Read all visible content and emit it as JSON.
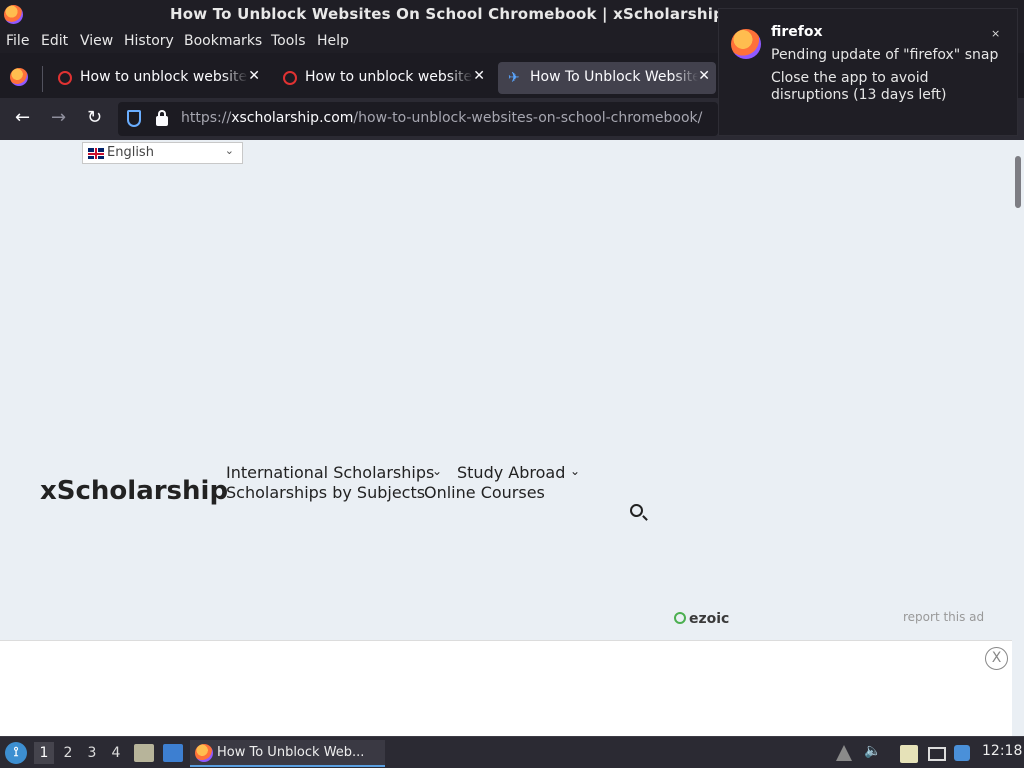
{
  "window": {
    "title": "How To Unblock Websites On School Chromebook | xScholarship -"
  },
  "menu": [
    "File",
    "Edit",
    "View",
    "History",
    "Bookmarks",
    "Tools",
    "Help"
  ],
  "tabs": [
    {
      "label": "How to unblock websites",
      "icon": "quora-icon",
      "active": false
    },
    {
      "label": "How to unblock websites",
      "icon": "quora-icon",
      "active": false
    },
    {
      "label": "How To Unblock Websites",
      "icon": "xscholarship-icon",
      "active": true
    }
  ],
  "urlbar": {
    "scheme": "https://",
    "domain": "xscholarship.com",
    "path": "/how-to-unblock-websites-on-school-chromebook/"
  },
  "page": {
    "language": "English",
    "brand": "xScholarship",
    "nav": [
      "International Scholarships",
      "Study Abroad",
      "Scholarships by Subjects",
      "Online Courses"
    ],
    "ad_brand": "ezoic",
    "report_ad": "report this ad",
    "ad_close": "X"
  },
  "notification": {
    "app": "firefox",
    "line1": "Pending update of \"firefox\" snap",
    "line2": "Close the app to avoid disruptions (13 days left)",
    "close": "×"
  },
  "taskbar": {
    "workspaces": [
      "1",
      "2",
      "3",
      "4"
    ],
    "task_label": "How To Unblock Web...",
    "clock": "12:18"
  },
  "colors": {
    "accent": "#5a9fe0",
    "firefox_orange": "#ff7139"
  }
}
